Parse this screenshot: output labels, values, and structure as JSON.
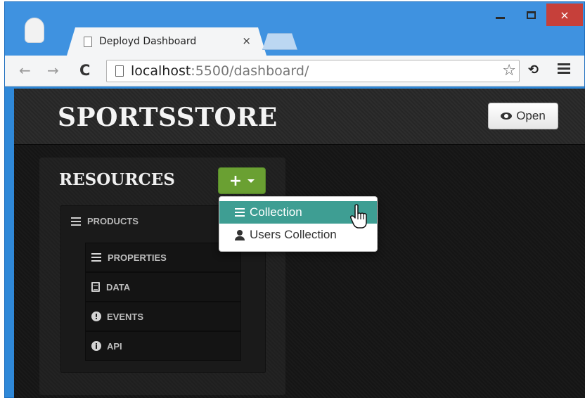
{
  "browser": {
    "tab_title": "Deployd Dashboard",
    "tab_close_glyph": "×",
    "url_host": "localhost",
    "url_rest": ":5500/dashboard/",
    "back_glyph": "←",
    "forward_glyph": "→",
    "reload_glyph": "C",
    "star_glyph": "☆",
    "extension_glyph": "⟲",
    "window_controls": {
      "minimize": "minimize-icon",
      "maximize": "maximize-icon",
      "close": "×"
    }
  },
  "dashboard": {
    "header": {
      "title": "SPORTSSTORE",
      "open_label": "Open"
    },
    "resources": {
      "title": "RESOURCES",
      "add_glyph": "+",
      "resource_name": "PRODUCTS",
      "subitems": [
        {
          "label": "PROPERTIES",
          "icon": "list-icon"
        },
        {
          "label": "DATA",
          "icon": "document-icon"
        },
        {
          "label": "EVENTS",
          "icon": "exclamation-icon",
          "glyph": "!"
        },
        {
          "label": "API",
          "icon": "info-icon",
          "glyph": "i"
        }
      ]
    },
    "dropdown": {
      "items": [
        {
          "label": "Collection",
          "icon": "list-icon",
          "active": true
        },
        {
          "label": "Users Collection",
          "icon": "user-icon",
          "active": false
        }
      ]
    }
  },
  "colors": {
    "add_button": "#6aa032",
    "dropdown_active": "#3e9e93",
    "window_frame": "#2f88d8",
    "close_button": "#c6403a"
  }
}
